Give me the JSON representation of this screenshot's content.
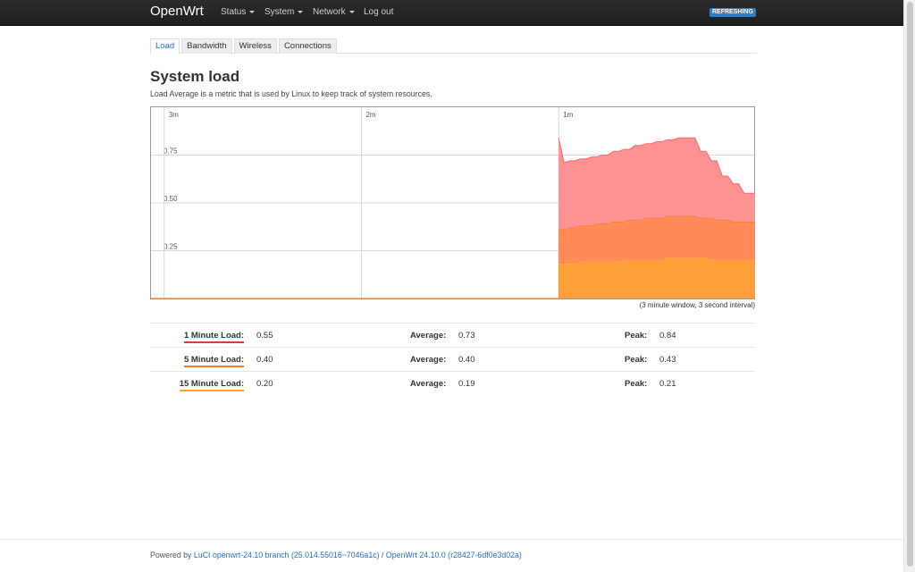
{
  "header": {
    "brand": "OpenWrt",
    "menu": [
      {
        "label": "Status",
        "dropdown": true
      },
      {
        "label": "System",
        "dropdown": true
      },
      {
        "label": "Network",
        "dropdown": true
      },
      {
        "label": "Log out",
        "dropdown": false
      }
    ],
    "indicator": "REFRESHING",
    "indicator_color": "#2d7ec8"
  },
  "tabs": [
    {
      "label": "Load",
      "active": true
    },
    {
      "label": "Bandwidth",
      "active": false
    },
    {
      "label": "Wireless",
      "active": false
    },
    {
      "label": "Connections",
      "active": false
    }
  ],
  "page": {
    "title": "System load",
    "description": "Load Average is a metric that is used by Linux to keep track of system resources."
  },
  "chart_data": {
    "type": "area",
    "x_tick_labels": [
      "3m",
      "2m",
      "1m"
    ],
    "x_tick_positions_seconds_ago": [
      180,
      120,
      60
    ],
    "y_tick_labels": [
      "0.75",
      "0.50",
      "0.25"
    ],
    "y_ticks": [
      0.75,
      0.5,
      0.25
    ],
    "ylim": [
      0,
      1.0
    ],
    "x_window_seconds": 184,
    "data_start_seconds_ago": 60,
    "note": "(3 minute window, 3 second interval)",
    "series": [
      {
        "name": "1 Minute Load",
        "color": "#ff6b6b",
        "fill": "#ff9393",
        "values": [
          0.84,
          0.71,
          0.72,
          0.72,
          0.73,
          0.73,
          0.74,
          0.74,
          0.75,
          0.75,
          0.77,
          0.77,
          0.78,
          0.78,
          0.8,
          0.8,
          0.81,
          0.81,
          0.82,
          0.82,
          0.83,
          0.83,
          0.84,
          0.84,
          0.84,
          0.84,
          0.77,
          0.77,
          0.72,
          0.72,
          0.64,
          0.64,
          0.6,
          0.6,
          0.55,
          0.55,
          0.55
        ]
      },
      {
        "name": "5 Minute Load",
        "color": "#ff7f3a",
        "fill": "#ff8c58",
        "values": [
          0.36,
          0.36,
          0.37,
          0.37,
          0.38,
          0.38,
          0.38,
          0.39,
          0.39,
          0.39,
          0.4,
          0.4,
          0.4,
          0.41,
          0.41,
          0.41,
          0.42,
          0.42,
          0.42,
          0.42,
          0.43,
          0.43,
          0.43,
          0.43,
          0.43,
          0.43,
          0.42,
          0.42,
          0.42,
          0.41,
          0.41,
          0.41,
          0.4,
          0.4,
          0.4,
          0.4,
          0.4
        ]
      },
      {
        "name": "15 Minute Load",
        "color": "#ffa640",
        "fill": "#ff9f3a",
        "values": [
          0.18,
          0.18,
          0.18,
          0.18,
          0.19,
          0.19,
          0.19,
          0.19,
          0.19,
          0.19,
          0.19,
          0.19,
          0.2,
          0.2,
          0.2,
          0.2,
          0.2,
          0.2,
          0.2,
          0.2,
          0.21,
          0.21,
          0.21,
          0.21,
          0.21,
          0.21,
          0.21,
          0.21,
          0.2,
          0.2,
          0.2,
          0.2,
          0.2,
          0.2,
          0.2,
          0.2,
          0.2
        ]
      }
    ]
  },
  "stats": {
    "avg_label": "Average:",
    "peak_label": "Peak:",
    "rows": [
      {
        "label": "1 Minute Load:",
        "current": "0.55",
        "average": "0.73",
        "peak": "0.84",
        "color": "#e03b3b"
      },
      {
        "label": "5 Minute Load:",
        "current": "0.40",
        "average": "0.40",
        "peak": "0.43",
        "color": "#f07a2a"
      },
      {
        "label": "15 Minute Load:",
        "current": "0.20",
        "average": "0.19",
        "peak": "0.21",
        "color": "#f5a623"
      }
    ]
  },
  "footer": {
    "prefix": "Powered by",
    "luci_link": "LuCI openwrt-24.10 branch (25.014.55016~7046a1c)",
    "separator": "/",
    "openwrt_link": "OpenWrt 24.10.0 (r28427-6df0e3d02a)"
  }
}
